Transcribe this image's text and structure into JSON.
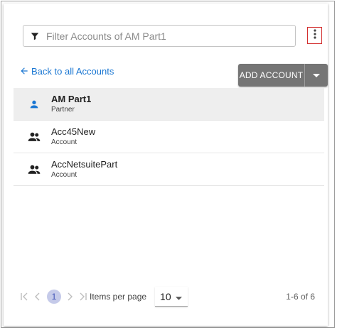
{
  "search": {
    "placeholder": "Filter Accounts of AM Part1",
    "value": ""
  },
  "header": {
    "back_label": "Back to all Accounts",
    "add_label": "ADD ACCOUNT"
  },
  "accounts": [
    {
      "name": "AM Part1",
      "type": "Partner",
      "icon": "person-icon"
    },
    {
      "name": "Acc45New",
      "type": "Account",
      "icon": "group-icon"
    },
    {
      "name": "AccNetsuitePart",
      "type": "Account",
      "icon": "group-icon"
    }
  ],
  "pagination": {
    "current_page": "1",
    "items_per_page_label": "Items per page",
    "items_per_page": "10",
    "range": "1-6 of 6"
  },
  "colors": {
    "accent": "#1976d2",
    "button": "#757575",
    "selected_row": "#eeeeee",
    "highlight_border": "#d32f2f"
  }
}
